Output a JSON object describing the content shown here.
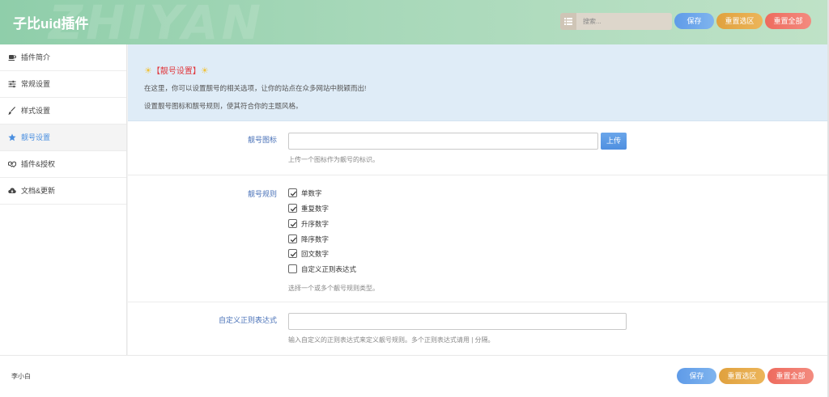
{
  "header": {
    "title": "子比uid插件",
    "watermark": "ZHIYAN",
    "search_placeholder": "搜索...",
    "save_label": "保存",
    "reset_section_label": "重置选区",
    "reset_all_label": "重置全部"
  },
  "sidebar": {
    "items": [
      {
        "label": "插件简介",
        "icon": "coffee-icon"
      },
      {
        "label": "常规设置",
        "icon": "sliders-icon"
      },
      {
        "label": "样式设置",
        "icon": "brush-icon"
      },
      {
        "label": "靓号设置",
        "icon": "star-icon",
        "active": true
      },
      {
        "label": "插件&授权",
        "icon": "handshake-icon"
      },
      {
        "label": "文档&更新",
        "icon": "cloud-download-icon"
      }
    ]
  },
  "notice": {
    "title": "【靓号设置】",
    "line1": "在这里，你可以设置靓号的相关选项，让你的站点在众多网站中脱颖而出!",
    "line2": "设置靓号图标和靓号规则，使其符合你的主题风格。"
  },
  "fields": {
    "icon": {
      "label": "靓号图标",
      "value": "",
      "upload_label": "上传",
      "help": "上传一个图标作为靓号的标识。"
    },
    "rules": {
      "label": "靓号规则",
      "options": [
        {
          "label": "单数字",
          "checked": true
        },
        {
          "label": "重复数字",
          "checked": true
        },
        {
          "label": "升序数字",
          "checked": true
        },
        {
          "label": "降序数字",
          "checked": true
        },
        {
          "label": "回文数字",
          "checked": true
        },
        {
          "label": "自定义正则表达式",
          "checked": false
        }
      ],
      "help": "选择一个或多个靓号规则类型。"
    },
    "regex": {
      "label": "自定义正则表达式",
      "value": "",
      "help": "输入自定义的正则表达式来定义靓号规则。多个正则表达式请用 | 分隔。"
    }
  },
  "footer": {
    "author": "李小白",
    "save_label": "保存",
    "reset_section_label": "重置选区",
    "reset_all_label": "重置全部"
  },
  "colors": {
    "header_green": "#a7d8b9",
    "accent_blue": "#4a8fe0",
    "save_blue": "#6aa6ea",
    "reset_orange": "#e6a94b",
    "reset_red": "#f07a6e",
    "notice_bg": "#dfecf7",
    "notice_title": "#e0393e"
  }
}
